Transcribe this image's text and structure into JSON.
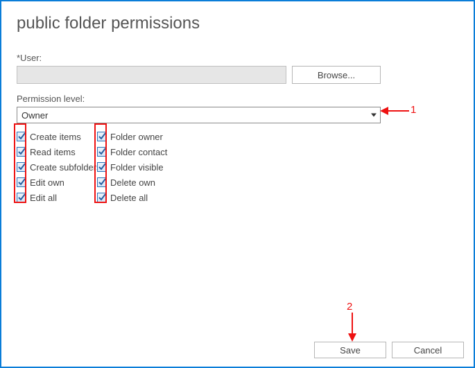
{
  "title": "public folder permissions",
  "user": {
    "label": "*User:",
    "value": "",
    "browse_label": "Browse..."
  },
  "permission": {
    "label": "Permission level:",
    "selected": "Owner",
    "options": [
      "Owner"
    ]
  },
  "perm_columns": {
    "col1": [
      {
        "label": "Create items",
        "checked": true
      },
      {
        "label": "Read items",
        "checked": true
      },
      {
        "label": "Create subfolders",
        "checked": true
      },
      {
        "label": "Edit own",
        "checked": true
      },
      {
        "label": "Edit all",
        "checked": true
      }
    ],
    "col2": [
      {
        "label": "Folder owner",
        "checked": true
      },
      {
        "label": "Folder contact",
        "checked": true
      },
      {
        "label": "Folder visible",
        "checked": true
      },
      {
        "label": "Delete own",
        "checked": true
      },
      {
        "label": "Delete all",
        "checked": true
      }
    ]
  },
  "footer": {
    "save_label": "Save",
    "cancel_label": "Cancel"
  },
  "annotations": {
    "label1": "1",
    "label2": "2"
  }
}
